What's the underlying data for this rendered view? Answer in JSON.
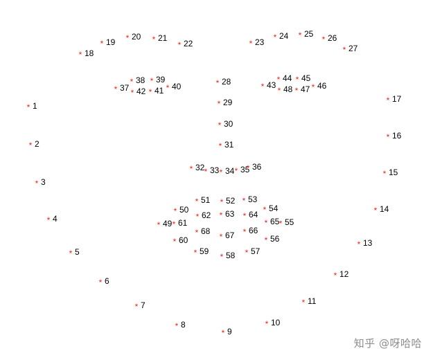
{
  "marker_symbol": "*",
  "marker_color": "#e8231e",
  "label_color": "#000000",
  "landmarks": [
    {
      "id": "1"
    },
    {
      "id": "2"
    },
    {
      "id": "3"
    },
    {
      "id": "4"
    },
    {
      "id": "5"
    },
    {
      "id": "6"
    },
    {
      "id": "7"
    },
    {
      "id": "8"
    },
    {
      "id": "9"
    },
    {
      "id": "10"
    },
    {
      "id": "11"
    },
    {
      "id": "12"
    },
    {
      "id": "13"
    },
    {
      "id": "14"
    },
    {
      "id": "15"
    },
    {
      "id": "16"
    },
    {
      "id": "17"
    },
    {
      "id": "18"
    },
    {
      "id": "19"
    },
    {
      "id": "20"
    },
    {
      "id": "21"
    },
    {
      "id": "22"
    },
    {
      "id": "23"
    },
    {
      "id": "24"
    },
    {
      "id": "25"
    },
    {
      "id": "26"
    },
    {
      "id": "27"
    },
    {
      "id": "28"
    },
    {
      "id": "29"
    },
    {
      "id": "30"
    },
    {
      "id": "31"
    },
    {
      "id": "32"
    },
    {
      "id": "33"
    },
    {
      "id": "34"
    },
    {
      "id": "35"
    },
    {
      "id": "36"
    },
    {
      "id": "37"
    },
    {
      "id": "38"
    },
    {
      "id": "39"
    },
    {
      "id": "40"
    },
    {
      "id": "41"
    },
    {
      "id": "42"
    },
    {
      "id": "43"
    },
    {
      "id": "44"
    },
    {
      "id": "45"
    },
    {
      "id": "46"
    },
    {
      "id": "47"
    },
    {
      "id": "48"
    },
    {
      "id": "49"
    },
    {
      "id": "50"
    },
    {
      "id": "51"
    },
    {
      "id": "52"
    },
    {
      "id": "53"
    },
    {
      "id": "54"
    },
    {
      "id": "55"
    },
    {
      "id": "56"
    },
    {
      "id": "57"
    },
    {
      "id": "58"
    },
    {
      "id": "59"
    },
    {
      "id": "60"
    },
    {
      "id": "61"
    },
    {
      "id": "62"
    },
    {
      "id": "63"
    },
    {
      "id": "64"
    },
    {
      "id": "65"
    },
    {
      "id": "66"
    },
    {
      "id": "67"
    },
    {
      "id": "68"
    }
  ],
  "watermark": "知乎 @呀哈哈"
}
